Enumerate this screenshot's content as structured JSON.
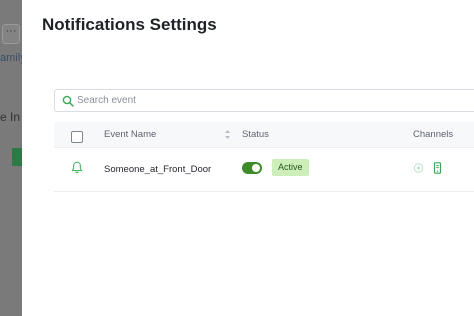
{
  "background": {
    "button_label": "···",
    "link_text": "amily",
    "text": "e In"
  },
  "modal": {
    "title": "Notifications Settings"
  },
  "search": {
    "placeholder": "Search event",
    "value": ""
  },
  "table": {
    "columns": {
      "event_name": "Event Name",
      "status": "Status",
      "channels": "Channels"
    },
    "rows": [
      {
        "event_name": "Someone_at_Front_Door",
        "enabled": true,
        "status": "Active",
        "channels": [
          "app-notification-icon",
          "mobile-phone-icon"
        ]
      }
    ]
  },
  "colors": {
    "accent_green": "#3d8b2a",
    "badge_bg": "#cdeeb9",
    "badge_text": "#245b19",
    "icon_green": "#4cb96a"
  }
}
